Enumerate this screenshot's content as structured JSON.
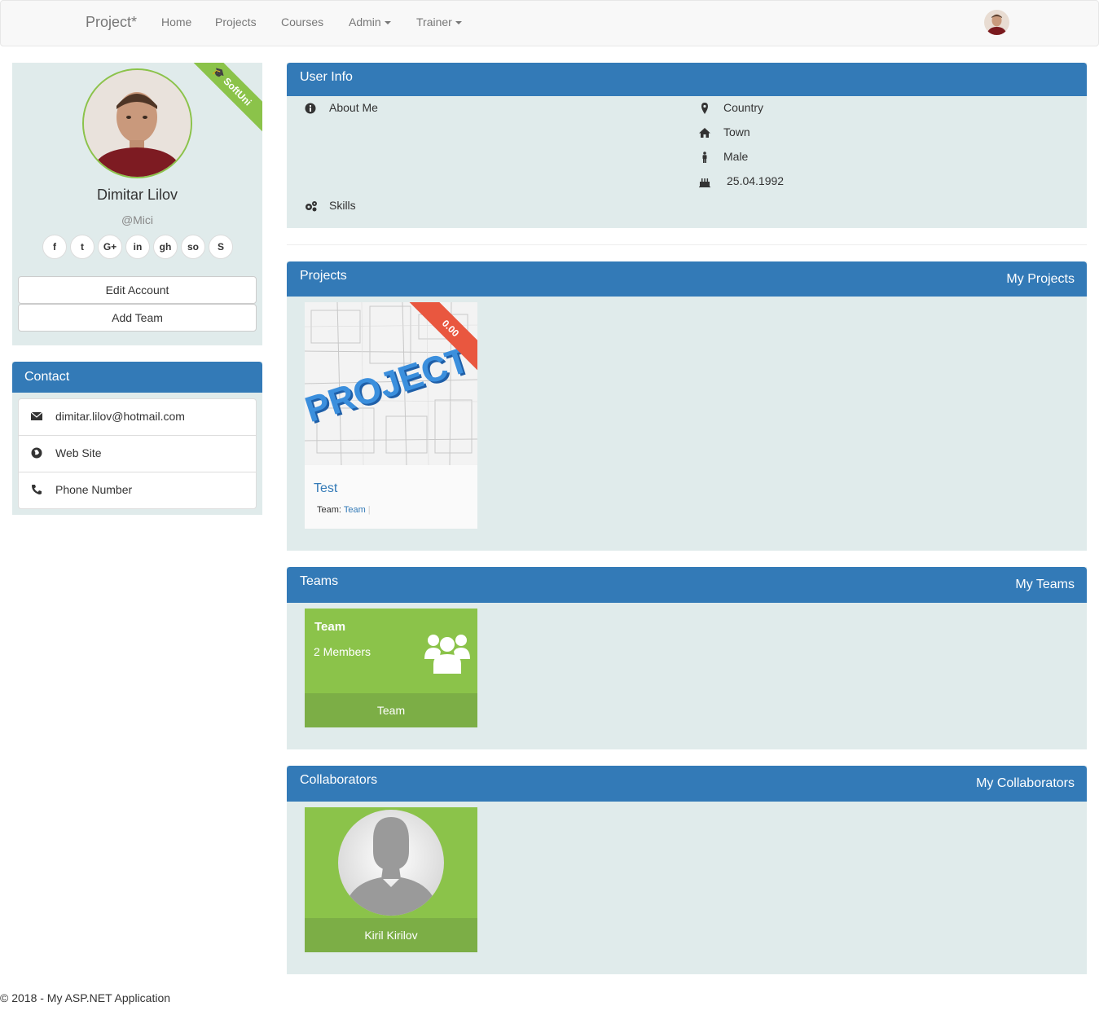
{
  "navbar": {
    "brand": "Project*",
    "links": [
      "Home",
      "Projects",
      "Courses"
    ],
    "admin": "Admin",
    "trainer": "Trainer"
  },
  "profile": {
    "ribbon": "SoftUni",
    "name": "Dimitar Lilov",
    "handle": "@Mici",
    "social": [
      {
        "icon": "facebook-icon",
        "glyph": "f"
      },
      {
        "icon": "twitter-icon",
        "glyph": "t"
      },
      {
        "icon": "google-plus-icon",
        "glyph": "G+"
      },
      {
        "icon": "linkedin-icon",
        "glyph": "in"
      },
      {
        "icon": "github-icon",
        "glyph": "gh"
      },
      {
        "icon": "stackoverflow-icon",
        "glyph": "so"
      },
      {
        "icon": "skype-icon",
        "glyph": "S"
      }
    ],
    "edit_account": "Edit Account",
    "add_team": "Add Team"
  },
  "contact": {
    "title": "Contact",
    "email": "dimitar.lilov@hotmail.com",
    "website": "Web Site",
    "phone": "Phone Number"
  },
  "user_info": {
    "title": "User Info",
    "about": "About Me",
    "skills": "Skills",
    "country": "Country",
    "town": "Town",
    "gender": "Male",
    "birthdate": "25.04.1992"
  },
  "projects": {
    "title": "Projects",
    "link": "My Projects",
    "card": {
      "image_text": "PROJECT",
      "rating": "0.00",
      "name": "Test",
      "team_label": "Team:",
      "team_name": "Team"
    }
  },
  "teams": {
    "title": "Teams",
    "link": "My Teams",
    "card": {
      "name": "Team",
      "members": "2 Members",
      "footer": "Team"
    }
  },
  "collaborators": {
    "title": "Collaborators",
    "link": "My Collaborators",
    "card": {
      "name": "Kiril Kirilov"
    }
  },
  "footer": "© 2018 - My ASP.NET Application",
  "colors": {
    "primary": "#337ab7",
    "panel_bg": "#e0ebeb",
    "green": "#8bc34a",
    "green_dark": "#7cae46",
    "ribbon_red": "#e9573f"
  }
}
